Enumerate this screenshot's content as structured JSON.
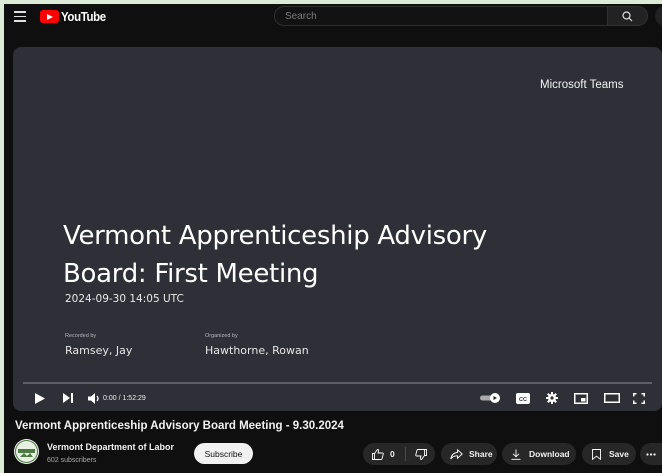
{
  "header": {
    "logo_text": "YouTube",
    "search_placeholder": "Search"
  },
  "video": {
    "brand": "Microsoft Teams",
    "title_line1": "Vermont Apprenticeship Advisory",
    "title_line2": "Board: First Meeting",
    "datetime": "2024-09-30 14:05 UTC",
    "recorded_by_label": "Recorded by",
    "recorded_by": "Ramsey, Jay",
    "organized_by_label": "Organized by",
    "organized_by": "Hawthorne, Rowan"
  },
  "player": {
    "time": "0:00 / 1:52:29",
    "progress": 0
  },
  "watch": {
    "title": "Vermont Apprenticeship Advisory Board Meeting - 9.30.2024",
    "channel_name": "Vermont Department of Labor",
    "subscribers": "602 subscribers",
    "subscribe_label": "Subscribe",
    "like_count": "0",
    "share_label": "Share",
    "download_label": "Download",
    "save_label": "Save"
  }
}
